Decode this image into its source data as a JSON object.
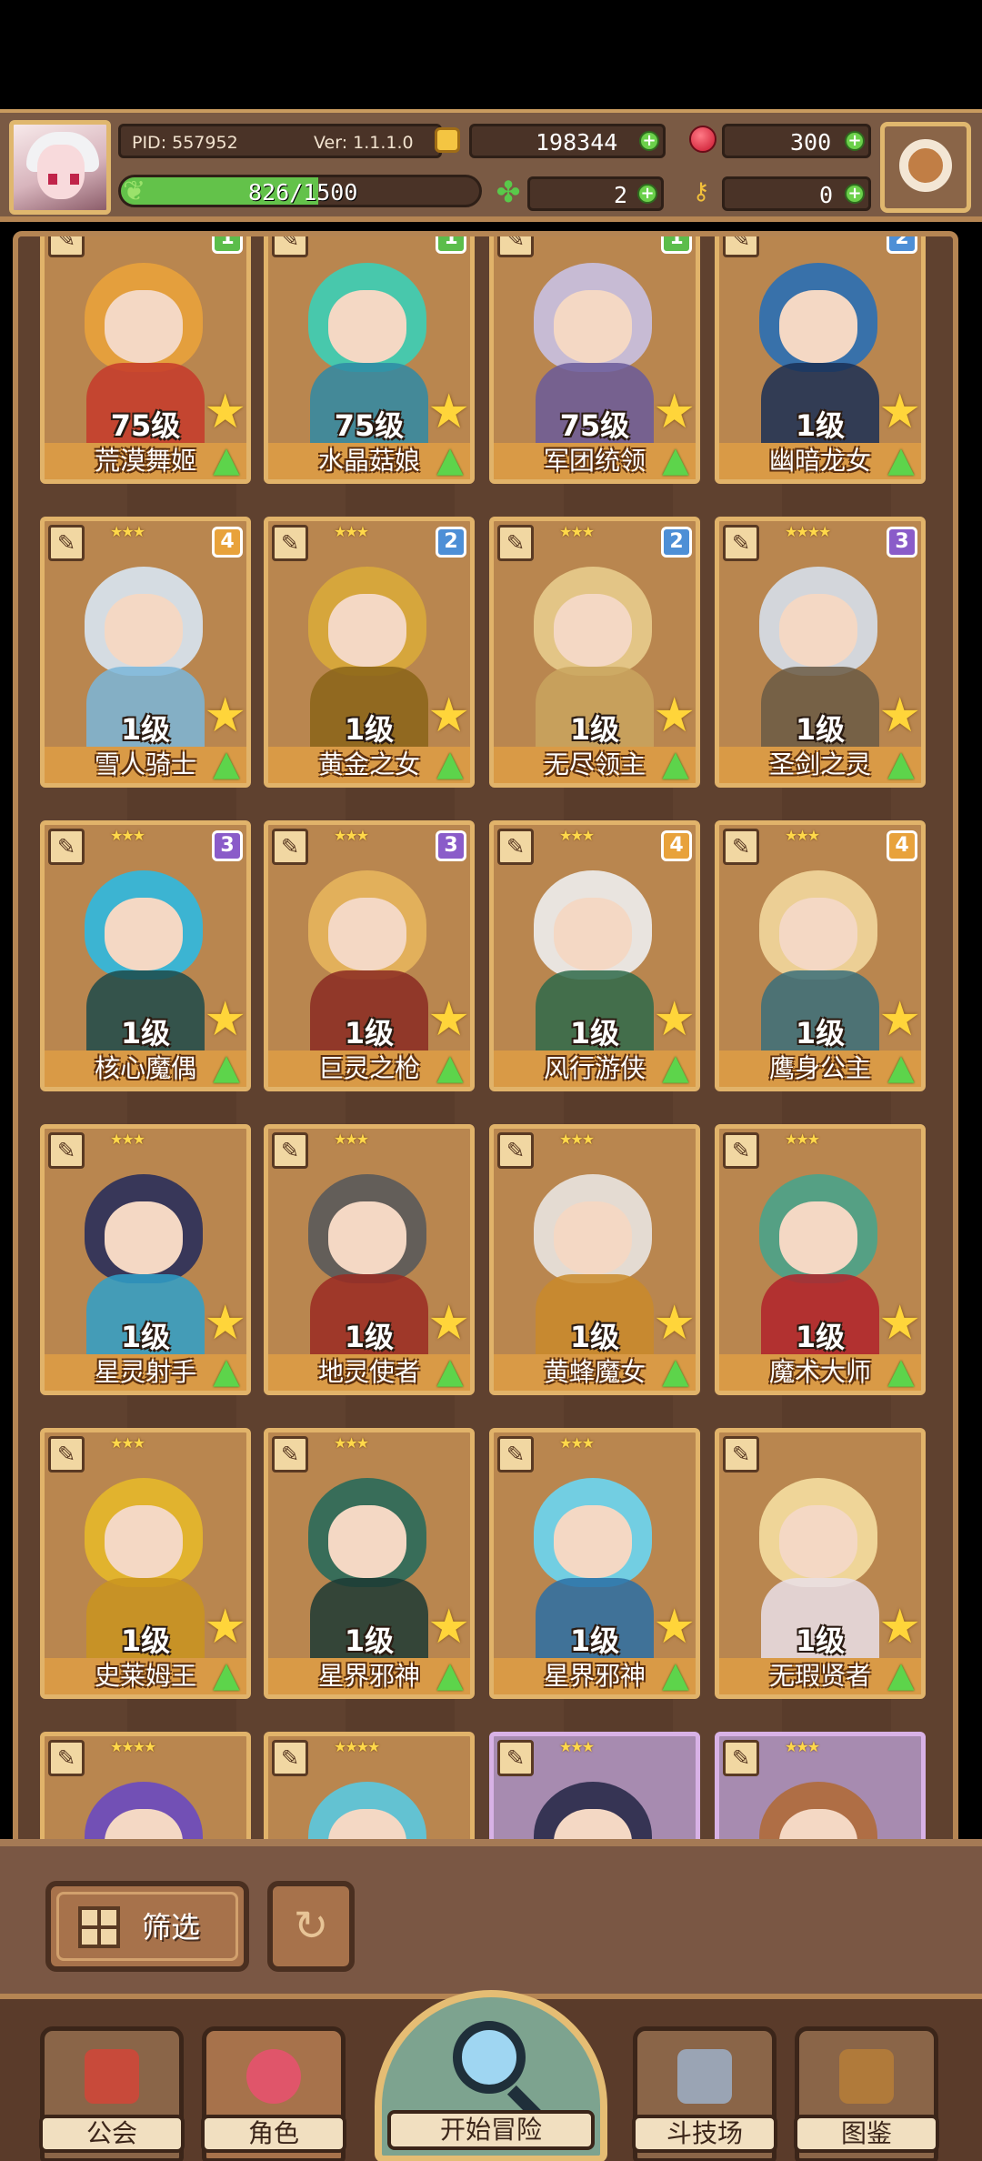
{
  "header": {
    "pid_label": "PID: 557952",
    "version_label": "Ver: 1.1.1.0",
    "gold": "198344",
    "gems": "300",
    "stamina": "826/1500",
    "stamina_fraction": 0.5507,
    "clover": "2",
    "keys": "0"
  },
  "heroes": [
    {
      "level": "75级",
      "name": "荒漠舞姬",
      "badge": "1",
      "stars": "★★★★",
      "badge_color": "#5bbd4b",
      "art": [
        "#e9a23b",
        "#c63a2a"
      ]
    },
    {
      "level": "75级",
      "name": "水晶菇娘",
      "badge": "1",
      "stars": "★★★★★",
      "badge_color": "#5bbd4b",
      "art": [
        "#3ccfb6",
        "#2f8aa4"
      ]
    },
    {
      "level": "75级",
      "name": "军团统领",
      "badge": "1",
      "stars": "★★★★",
      "badge_color": "#5bbd4b",
      "art": [
        "#c9c1e2",
        "#6a5a9a"
      ]
    },
    {
      "level": "1级",
      "name": "幽暗龙女",
      "badge": "2",
      "stars": "★★★★",
      "badge_color": "#4d8fd6",
      "art": [
        "#2a6fb4",
        "#1a2f55"
      ]
    },
    {
      "level": "1级",
      "name": "雪人骑士",
      "badge": "4",
      "stars": "★★★",
      "badge_color": "#e8a23b",
      "art": [
        "#d8e6f2",
        "#7ab6d9"
      ]
    },
    {
      "level": "1级",
      "name": "黄金之女",
      "badge": "2",
      "stars": "★★★",
      "badge_color": "#4d8fd6",
      "art": [
        "#d9aa3a",
        "#8a6418"
      ]
    },
    {
      "level": "1级",
      "name": "无尽领主",
      "badge": "2",
      "stars": "★★★",
      "badge_color": "#4d8fd6",
      "art": [
        "#e8cc8c",
        "#c9a45e"
      ]
    },
    {
      "level": "1级",
      "name": "圣剑之灵",
      "badge": "3",
      "stars": "★★★★",
      "badge_color": "#8a5cc9",
      "art": [
        "#d6dfea",
        "#6a5a44"
      ]
    },
    {
      "level": "1级",
      "name": "核心魔偶",
      "badge": "3",
      "stars": "★★★",
      "badge_color": "#8a5cc9",
      "art": [
        "#2fb9e0",
        "#1c4a4a"
      ]
    },
    {
      "level": "1级",
      "name": "巨灵之枪",
      "badge": "3",
      "stars": "★★★",
      "badge_color": "#8a5cc9",
      "art": [
        "#e7b55c",
        "#8a2a22"
      ]
    },
    {
      "level": "1级",
      "name": "风行游侠",
      "badge": "4",
      "stars": "★★★",
      "badge_color": "#e8a23b",
      "art": [
        "#eeeeee",
        "#2e6a4a"
      ]
    },
    {
      "level": "1级",
      "name": "鹰身公主",
      "badge": "4",
      "stars": "★★★",
      "badge_color": "#e8a23b",
      "art": [
        "#f2d79c",
        "#3a6f7a"
      ]
    },
    {
      "level": "1级",
      "name": "星灵射手",
      "badge": "",
      "stars": "★★★",
      "badge_color": "",
      "art": [
        "#2a2f5a",
        "#2fa0c9"
      ]
    },
    {
      "level": "1级",
      "name": "地灵使者",
      "badge": "",
      "stars": "★★★",
      "badge_color": "",
      "art": [
        "#5a5a5a",
        "#9a2a22"
      ]
    },
    {
      "level": "1级",
      "name": "黄蜂魔女",
      "badge": "",
      "stars": "★★★",
      "badge_color": "",
      "art": [
        "#e9e4e0",
        "#c98a2a"
      ]
    },
    {
      "level": "1级",
      "name": "魔术大师",
      "badge": "",
      "stars": "★★★",
      "badge_color": "",
      "art": [
        "#4aa38a",
        "#b0222a"
      ]
    },
    {
      "level": "1级",
      "name": "史莱姆王",
      "badge": "",
      "stars": "★★★",
      "badge_color": "",
      "art": [
        "#e6b82a",
        "#c9941e"
      ]
    },
    {
      "level": "1级",
      "name": "星界邪神",
      "badge": "",
      "stars": "★★★",
      "badge_color": "",
      "art": [
        "#2a6a5a",
        "#1c3a34"
      ]
    },
    {
      "level": "1级",
      "name": "星界邪神",
      "badge": "",
      "stars": "★★★",
      "badge_color": "",
      "art": [
        "#6ad6f2",
        "#2a6fa4"
      ]
    },
    {
      "level": "1级",
      "name": "无瑕贤者",
      "badge": "",
      "stars": "",
      "badge_color": "",
      "art": [
        "#f5dea0",
        "#e9dfe8"
      ]
    }
  ],
  "partial_row": [
    {
      "stars": "★★★★",
      "art": [
        "#6a4ac0",
        "#2a2a6a"
      ],
      "purple": false
    },
    {
      "stars": "★★★★",
      "art": [
        "#5ac9e0",
        "#2a7aa0"
      ],
      "purple": false
    },
    {
      "stars": "★★★",
      "art": [
        "#2a2a4a",
        "#3a3a5a"
      ],
      "purple": true
    },
    {
      "stars": "★★★",
      "art": [
        "#b06a3a",
        "#6a3a2a"
      ],
      "purple": true
    }
  ],
  "controls": {
    "filter_label": "筛选"
  },
  "nav": {
    "guild": "公会",
    "heroes": "角色",
    "adventure": "开始冒险",
    "arena": "斗技场",
    "codex": "图鉴"
  },
  "colors": {
    "gold_border": "#e1b36a",
    "nav_label_bg": "#f1dfc0",
    "frame_brown": "#7a5a44"
  }
}
